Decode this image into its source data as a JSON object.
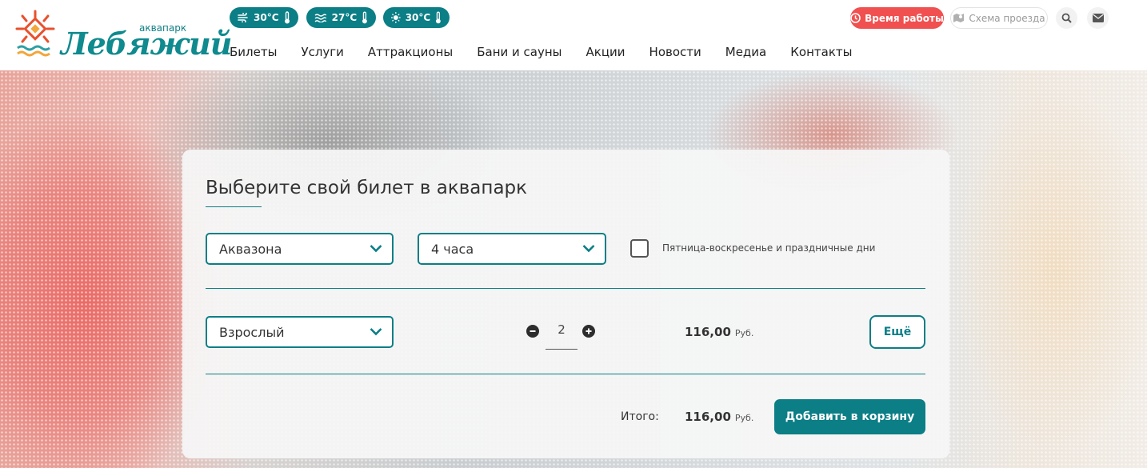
{
  "brand": {
    "small_text": "аквапарк",
    "name": "Лебяжий"
  },
  "weather": [
    {
      "icon": "wind-icon",
      "value": "30°C"
    },
    {
      "icon": "water-icon",
      "value": "27°C"
    },
    {
      "icon": "sun-icon",
      "value": "30°C"
    }
  ],
  "nav": {
    "items": [
      "Билеты",
      "Услуги",
      "Аттракционы",
      "Бани и сауны",
      "Акции",
      "Новости",
      "Медиа",
      "Контакты"
    ]
  },
  "header_actions": {
    "hours_label": "Время работы",
    "route_label": "Схема проезда"
  },
  "booking": {
    "title": "Выберите свой билет в аквапарк",
    "zone_select": "Аквазона",
    "duration_select": "4 часа",
    "weekend_checkbox_label": "Пятница-воскресенье и праздничные дни",
    "weekend_checked": false,
    "ticket_type_select": "Взрослый",
    "quantity": "2",
    "price": "116,00",
    "currency": "Руб.",
    "more_label": "Ещё",
    "total_label": "Итого:",
    "total_price": "116,00",
    "total_currency": "Руб.",
    "add_to_cart_label": "Добавить в корзину"
  },
  "colors": {
    "accent": "#0b7e86",
    "hours_button": "#f0504f"
  }
}
